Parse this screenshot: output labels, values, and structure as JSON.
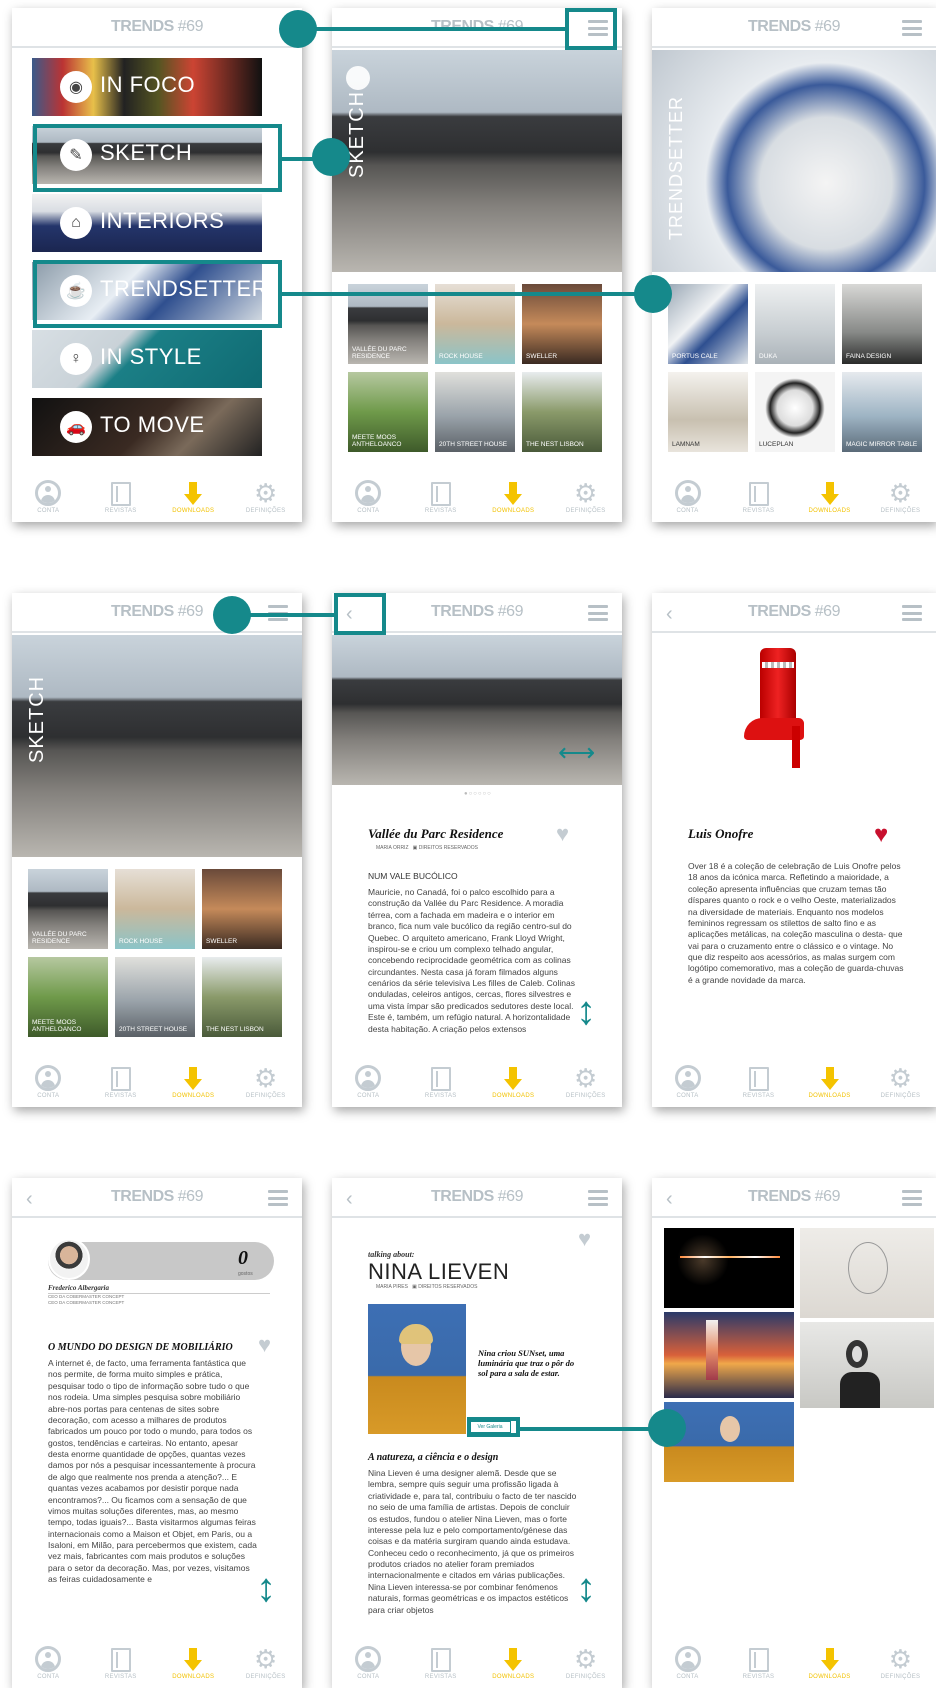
{
  "brand": {
    "name": "TRENDS",
    "issue": "#69"
  },
  "nav": [
    {
      "label": "CONTA"
    },
    {
      "label": "REVISTAS"
    },
    {
      "label": "DOWNLOADS"
    },
    {
      "label": "DEFINIÇÕES"
    }
  ],
  "menu": {
    "items": [
      {
        "label": "IN FOCO"
      },
      {
        "label": "SKETCH"
      },
      {
        "label": "INTERIORS"
      },
      {
        "label": "TRENDSETTER"
      },
      {
        "label": "IN STYLE"
      },
      {
        "label": "TO MOVE"
      }
    ]
  },
  "sketch": {
    "vertical_label": "SKETCH",
    "tiles": [
      "VALLÉE DU PARC RESIDENCE",
      "ROCK HOUSE",
      "SWELLER",
      "MEETE MOOS ANTHELOANCO",
      "20TH STREET HOUSE",
      "THE NEST LISBON"
    ]
  },
  "trendsetter": {
    "vertical_label": "TRENDSETTER",
    "tiles": [
      "PORTUS CALE",
      "DUKA",
      "FAINA DESIGN",
      "LAMNAM",
      "LUCEPLAN",
      "MAGIC MIRROR TABLE"
    ]
  },
  "article1": {
    "title": "Vallée du Parc Residence",
    "author": "MARIA ORRIZ",
    "rights": "DIREITOS RESERVADOS",
    "subhead": "NUM VALE BUCÓLICO",
    "body": "Mauricie, no Canadá, foi o palco escolhido para a construção da Vallée du Parc Residence. A moradia térrea, com a fachada em madeira e o interior em branco, fica num vale bucólico da região centro-sul do Quebec. O arquiteto americano, Frank Lloyd Wright, inspirou-se e criou um complexo telhado angular, concebendo reciprocidade geométrica com as colinas circundantes. Nesta casa já foram filmados alguns cenários da série televisiva Les filles de Caleb. Colinas onduladas, celeiros antigos, cercas, flores silvestres e uma vista ímpar são predicados sedutores deste local. Este é, também, um refúgio natural. A horizontalidade desta habitação. A criação pelos extensos"
  },
  "article2": {
    "title": "Luis Onofre",
    "body": "Over 18 é a coleção de celebração de Luis Onofre pelos 18 anos da icónica marca. Refletindo a maioridade, a coleção apresenta influências que cruzam temas tão díspares quanto o rock e o velho Oeste, materializados na diversidade de materiais. Enquanto nos modelos femininos regressam os stilettos de salto fino e as aplicações metálicas, na coleção masculina o desta- que vai para o cruzamento entre o clássico e o vintage. No que diz respeito aos acessórios, as malas surgem com logótipo comemorativo, mas a coleção de guarda-chuvas é a grande novidade da marca."
  },
  "article3": {
    "author": "Frederico Albergaria",
    "role1": "CEO DA COBERMASTER CONCEPT",
    "role2": "CEO DA COBERMASTER CONCEPT",
    "count": "0",
    "count_label": "gostos",
    "title": "O MUNDO DO DESIGN DE MOBILIÁRIO",
    "body": "A internet é, de facto, uma ferramenta fantástica que nos permite, de forma muito simples e prática, pesquisar todo o tipo de informação sobre tudo o que nos rodeia. Uma simples pesquisa sobre mobiliário abre-nos portas para centenas de sites sobre decoração, com acesso a milhares de produtos fabricados um pouco por todo o mundo, para todos os gostos, tendências e carteiras. No entanto, apesar desta enorme quantidade de opções, quantas vezes damos por nós a pesquisar incessantemente à procura de algo que realmente nos prenda a atenção?... E quantas vezes acabamos por desistir porque nada encontramos?... Ou ficamos com a sensação de que vimos muitas soluções diferentes, mas, ao mesmo tempo, todas iguais?... Basta visitarmos algumas feiras internacionais como a Maison et Objet, em Paris, ou a Isaloni, em Milão, para percebermos que existem, cada vez mais, fabricantes com mais produtos e soluções para o setor da decoração. Mas, por vezes, visitamos as feiras cuidadosamente e"
  },
  "article4": {
    "kicker": "talking about:",
    "name": "NINA LIEVEN",
    "author": "MARIA PIRES",
    "rights": "DIREITOS RESERVADOS",
    "quote": "Nina criou SUNset, uma luminária que traz o pôr do sol para a sala de estar.",
    "gallery_button": "Ver Galeria",
    "subhead": "A natureza, a ciência e o design",
    "body": "Nina Lieven é uma designer alemã. Desde que se lembra, sempre quis seguir uma profissão ligada à criatividade e, para tal, contribuiu o facto de ter nascido no seio de uma família de artistas. Depois de concluir os estudos, fundou o atelier Nina Lieven, mas o forte interesse pela luz e pelo comportamento/génese das coisas e da matéria surgiram quando ainda estudava. Conheceu cedo o reconhecimento, já que os primeiros produtos criados no atelier foram premiados internacionalmente e citados em várias publicações. Nina Lieven interessa-se por combinar fenómenos naturais, formas geométricas e os impactos estéticos para criar objetos"
  },
  "colors": {
    "teal": "#15898b",
    "yellow": "#f4c300",
    "grey": "#b7c0c6",
    "heart_red": "#c8102e"
  }
}
